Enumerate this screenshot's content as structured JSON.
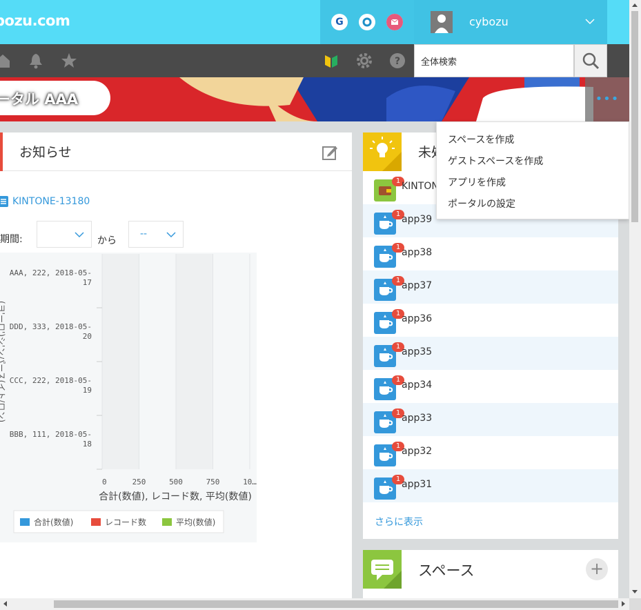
{
  "header": {
    "logo_text": "bozu.com",
    "user_name": "cybozu",
    "services": [
      {
        "name": "g-icon",
        "letter": "G",
        "color": "#1a5fb4"
      },
      {
        "name": "circle-o-icon",
        "letter": "",
        "color": "#1e90c8"
      },
      {
        "name": "mail-icon",
        "letter": "",
        "color": "#e75a7c"
      }
    ]
  },
  "toolbar": {
    "search_placeholder": "全体検索"
  },
  "banner": {
    "title": "ータル AAA",
    "more_label": "•••"
  },
  "menu": {
    "items": [
      "スペースを作成",
      "ゲストスペースを作成",
      "アプリを作成",
      "ポータルの設定"
    ]
  },
  "notice": {
    "title": "お知らせ",
    "link": "KINTONE-13180",
    "filter_label": "期間:",
    "filter_from": "から",
    "select2_value": "--",
    "chart_data": {
      "type": "bar",
      "orientation": "horizontal",
      "categories": [
        "AAA, 222, 2018-05-17",
        "DDD, 333, 2018-05-20",
        "CCC, 222, 2018-05-19",
        "BBB, 111, 2018-05-18"
      ],
      "category_lines": [
        [
          "AAA, 222, 2018-05-",
          "17"
        ],
        [
          "DDD, 333, 2018-05-",
          "20"
        ],
        [
          "CCC, 222, 2018-05-",
          "19"
        ],
        [
          "BBB, 111, 2018-05-",
          "18"
        ]
      ],
      "series": [
        {
          "name": "合計(数値)",
          "color": "#3498db",
          "values": [
            0,
            0,
            0,
            0
          ]
        },
        {
          "name": "レコード数",
          "color": "#e74c3c",
          "values": [
            0,
            0,
            0,
            0
          ]
        },
        {
          "name": "平均(数値)",
          "color": "#8cc63f",
          "values": [
            0,
            0,
            0,
            0
          ]
        }
      ],
      "xticks": [
        "0",
        "250",
        "500",
        "750",
        "10…"
      ],
      "xlim": [
        0,
        1000
      ],
      "xlabel": "合計(数値), レコード数, 平均(数値)",
      "ylabel": "(ヨ'ーロ')シ'ンパース(イト/ロン)",
      "grid": true,
      "legend_position": "bottom-left"
    }
  },
  "unread": {
    "title": "未処",
    "more_label": "さらに表示",
    "rows": [
      {
        "label": "KINTONE",
        "badge": "1",
        "icon": "wallet-app-icon"
      },
      {
        "label": "app39",
        "badge": "1",
        "icon": "cup-app-icon"
      },
      {
        "label": "app38",
        "badge": "1",
        "icon": "cup-app-icon"
      },
      {
        "label": "app37",
        "badge": "1",
        "icon": "cup-app-icon"
      },
      {
        "label": "app36",
        "badge": "1",
        "icon": "cup-app-icon"
      },
      {
        "label": "app35",
        "badge": "1",
        "icon": "cup-app-icon"
      },
      {
        "label": "app34",
        "badge": "1",
        "icon": "cup-app-icon"
      },
      {
        "label": "app33",
        "badge": "1",
        "icon": "cup-app-icon"
      },
      {
        "label": "app32",
        "badge": "1",
        "icon": "cup-app-icon"
      },
      {
        "label": "app31",
        "badge": "1",
        "icon": "cup-app-icon"
      }
    ]
  },
  "space": {
    "title": "スペース",
    "plus_label": "+"
  },
  "colors": {
    "header": "#55dcf7",
    "toolbar": "#4a4a4a",
    "accent": "#3498db",
    "badge": "#e74c3c"
  }
}
